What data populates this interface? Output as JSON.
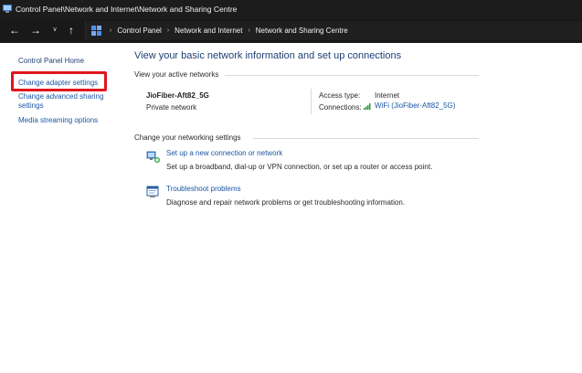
{
  "window": {
    "title": "Control Panel\\Network and Internet\\Network and Sharing Centre"
  },
  "address": {
    "crumbs": [
      "Control Panel",
      "Network and Internet",
      "Network and Sharing Centre"
    ]
  },
  "sidebar": {
    "items": [
      {
        "label": "Control Panel Home"
      },
      {
        "label": "Change adapter settings"
      },
      {
        "label": "Change advanced sharing settings"
      },
      {
        "label": "Media streaming options"
      }
    ]
  },
  "main": {
    "heading": "View your basic network information and set up connections",
    "active_networks_label": "View your active networks",
    "network": {
      "name": "JioFiber-Aft82_5G",
      "type": "Private network",
      "access_type_label": "Access type:",
      "access_type_value": "Internet",
      "connections_label": "Connections:",
      "connection_link": "WiFi (JioFiber-Aft82_5G)"
    },
    "change_settings_label": "Change your networking settings",
    "tasks": [
      {
        "link": "Set up a new connection or network",
        "desc": "Set up a broadband, dial-up or VPN connection, or set up a router or access point."
      },
      {
        "link": "Troubleshoot problems",
        "desc": "Diagnose and repair network problems or get troubleshooting information."
      }
    ]
  },
  "colors": {
    "link": "#1a56a6",
    "heading": "#1e3f75",
    "highlight": "#e0161e",
    "titlebar": "#1c1c1c"
  }
}
